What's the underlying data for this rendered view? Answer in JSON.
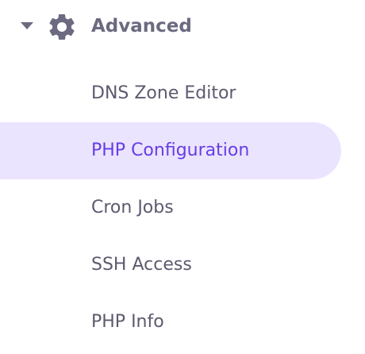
{
  "section": {
    "title": "Advanced",
    "icon": "gear-icon",
    "expanded": true
  },
  "colors": {
    "text": "#5b5a6e",
    "header": "#6b6a80",
    "active_text": "#673de6",
    "active_bg": "#ebe4ff"
  },
  "menu": {
    "items": [
      {
        "label": "DNS Zone Editor",
        "active": false
      },
      {
        "label": "PHP Configuration",
        "active": true
      },
      {
        "label": "Cron Jobs",
        "active": false
      },
      {
        "label": "SSH Access",
        "active": false
      },
      {
        "label": "PHP Info",
        "active": false
      }
    ]
  }
}
